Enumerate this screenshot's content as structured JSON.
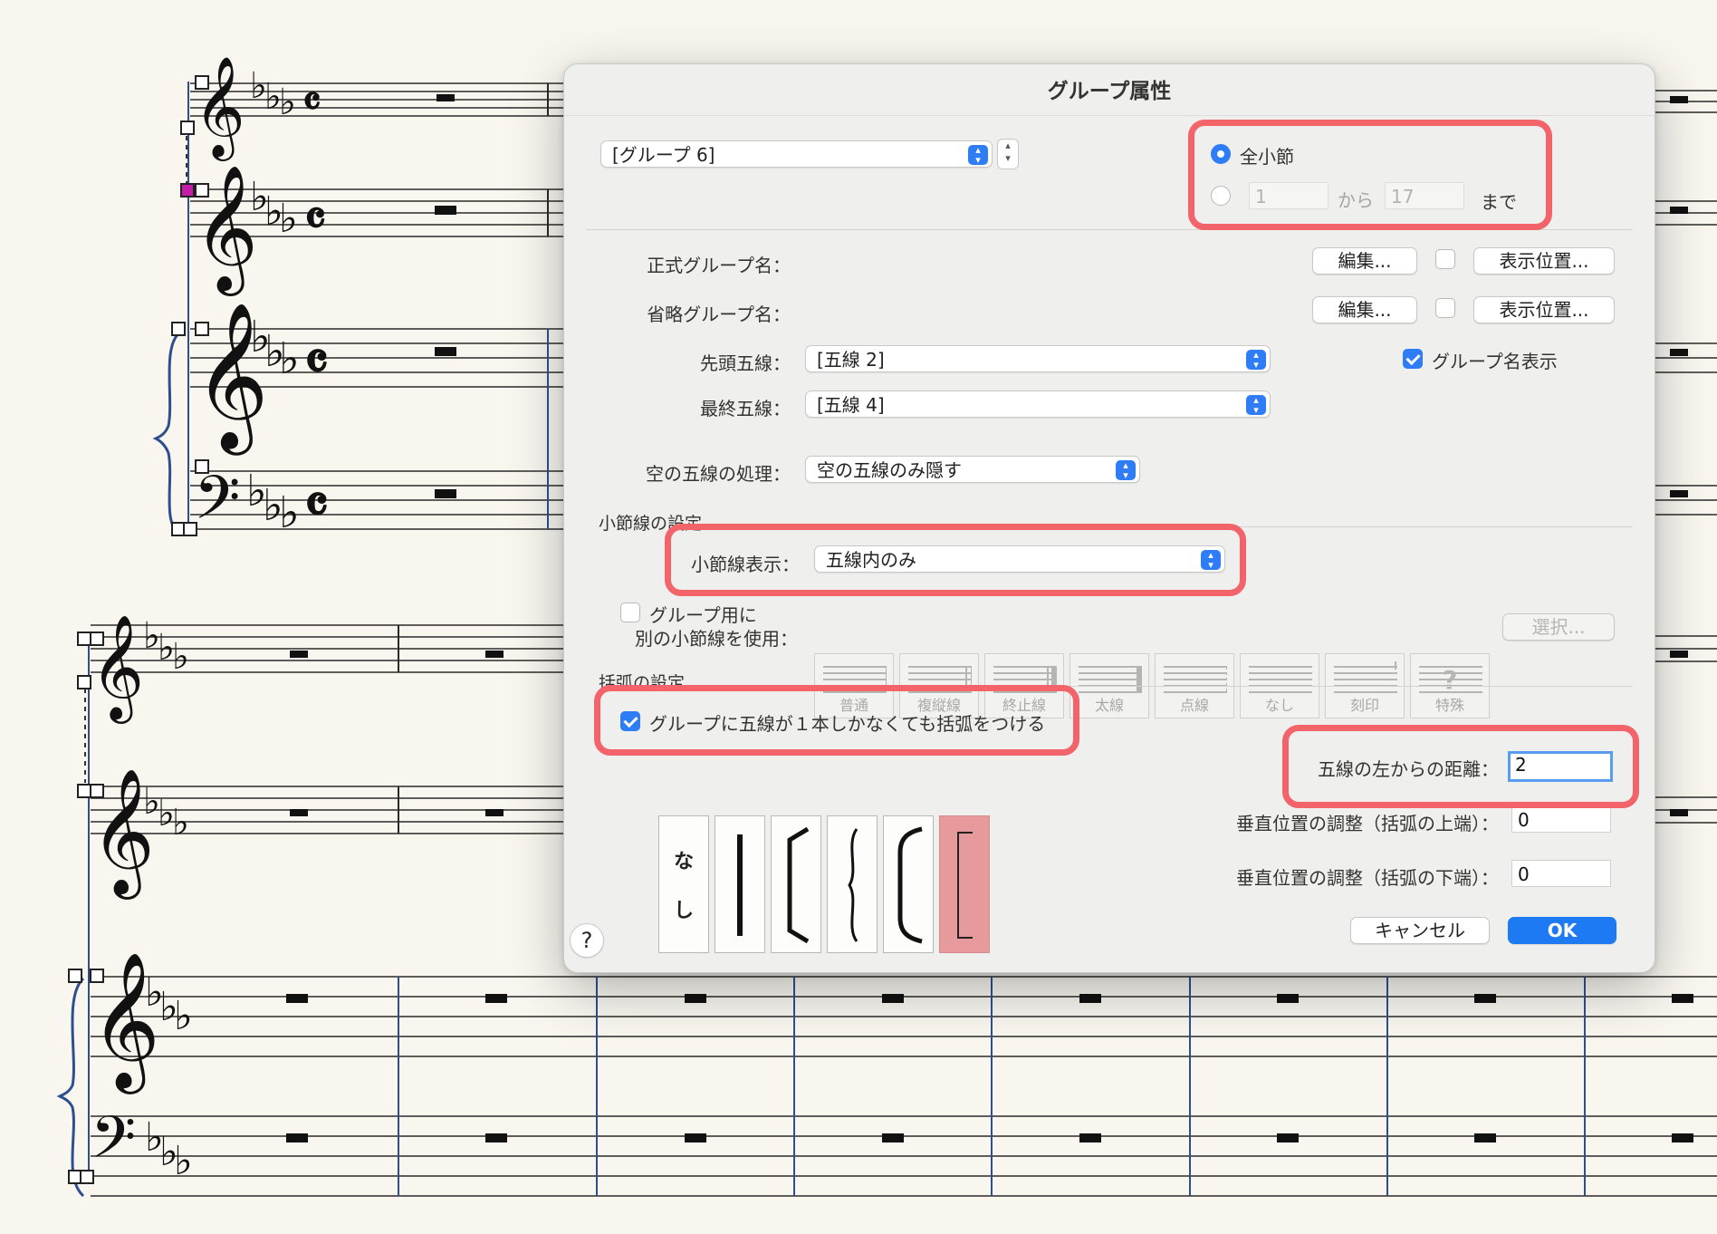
{
  "dialog": {
    "title": "グループ属性",
    "group_popup": "[グループ 6]",
    "range": {
      "all_measures": "全小節",
      "from_value": "1",
      "from_label": "から",
      "to_value": "17",
      "to_label": "まで"
    },
    "full_name_label": "正式グループ名：",
    "abbrev_name_label": "省略グループ名：",
    "edit_button": "編集...",
    "position_button": "表示位置...",
    "top_staff_label": "先頭五線：",
    "top_staff_value": "[五線 2]",
    "bottom_staff_label": "最終五線：",
    "bottom_staff_value": "[五線 4]",
    "show_group_name": "グループ名表示",
    "empty_staff_label": "空の五線の処理：",
    "empty_staff_value": "空の五線のみ隠す",
    "barline_section": "小節線の設定",
    "barline_display_label": "小節線表示：",
    "barline_display_value": "五線内のみ",
    "alt_barline_line1": "グループ用に",
    "alt_barline_line2": "別の小節線を使用：",
    "barline_types": [
      "普通",
      "複縦線",
      "終止線",
      "太線",
      "点線",
      "なし",
      "刻印",
      "特殊"
    ],
    "select_button": "選択...",
    "bracket_section": "括弧の設定",
    "single_staff_bracket": "グループに五線が１本しかなくても括弧をつける",
    "bracket_none_1": "な",
    "bracket_none_2": "し",
    "distance_label": "五線の左からの距離：",
    "distance_value": "2",
    "vert_top_label": "垂直位置の調整（括弧の上端）：",
    "vert_top_value": "0",
    "vert_bottom_label": "垂直位置の調整（括弧の下端）：",
    "vert_bottom_value": "0",
    "help_button": "?",
    "cancel_button": "キャンセル",
    "ok_button": "OK"
  },
  "colors": {
    "accent_blue": "#2e7cf6",
    "highlight_red": "#f2646a",
    "selected_bracket": "#e79a9c",
    "paper": "#f8f6ef"
  }
}
